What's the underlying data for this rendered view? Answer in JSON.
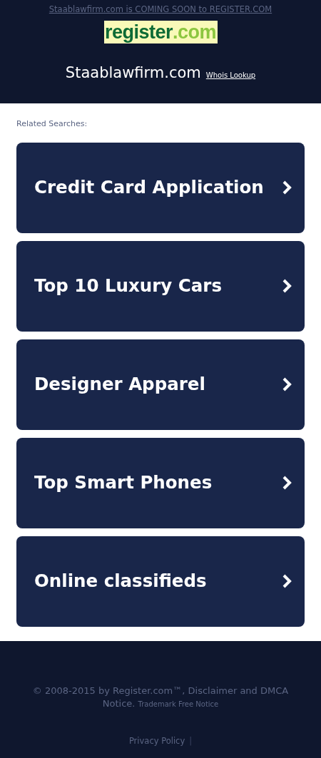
{
  "banner": {
    "notice": "Staablawfirm.com is COMING SOON to REGISTER.COM",
    "logo": {
      "name": "register",
      "suffix": ".com"
    },
    "domain": "Staablawfirm.com",
    "whois_link": "Whois Lookup"
  },
  "related": {
    "label": "Related Searches:",
    "items": [
      {
        "label": "Credit Card Application"
      },
      {
        "label": "Top 10 Luxury Cars"
      },
      {
        "label": "Designer Apparel"
      },
      {
        "label": "Top Smart Phones"
      },
      {
        "label": "Online classifieds"
      }
    ]
  },
  "footer": {
    "copyright": "© 2008-2015 by Register.com™, Disclaimer and DMCA Notice.",
    "trademark_link": "Trademark Free Notice",
    "privacy_link": "Privacy Policy",
    "separator": "|"
  }
}
